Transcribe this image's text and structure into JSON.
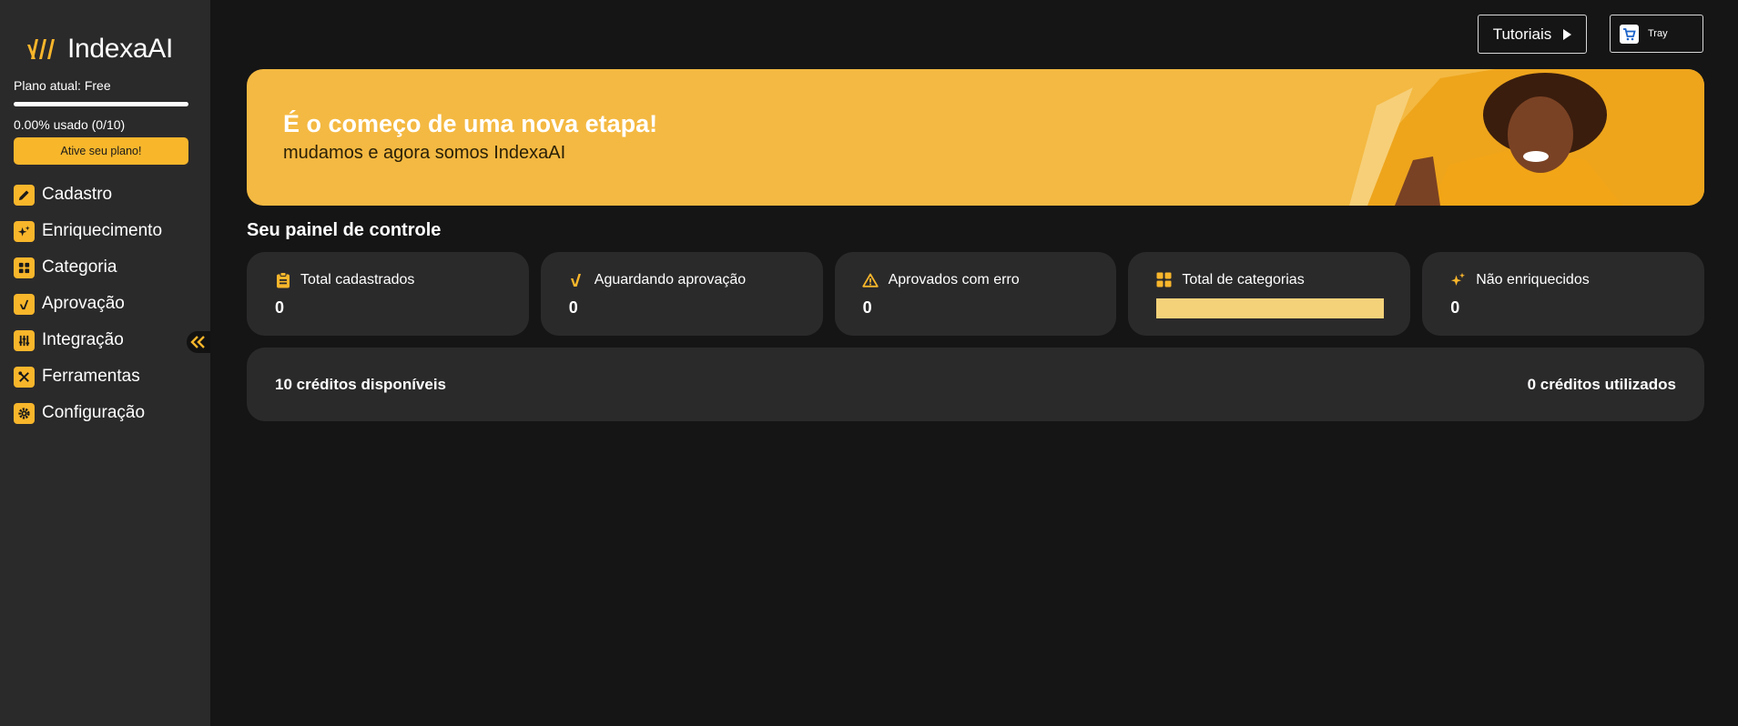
{
  "brand": {
    "name": "IndexaAI",
    "accent": "#f8b62b"
  },
  "sidebar": {
    "plan_label": "Plano atual: Free",
    "usage_fraction": 0.0,
    "usage_label": "0.00% usado (0/10)",
    "activate_label": "Ative seu plano!",
    "items": [
      {
        "label": "Cadastro",
        "icon": "pencil-icon"
      },
      {
        "label": "Enriquecimento",
        "icon": "sparkles-icon"
      },
      {
        "label": "Categoria",
        "icon": "grid-icon"
      },
      {
        "label": "Aprovação",
        "icon": "check-icon"
      },
      {
        "label": "Integração",
        "icon": "sliders-icon"
      },
      {
        "label": "Ferramentas",
        "icon": "tools-icon"
      },
      {
        "label": "Configuração",
        "icon": "gear-icon"
      }
    ]
  },
  "topbar": {
    "tutorials_label": "Tutoriais",
    "integration_label": "Tray"
  },
  "banner": {
    "title": "É o começo de uma nova etapa!",
    "subtitle": "mudamos e agora somos IndexaAI"
  },
  "panel": {
    "title": "Seu painel de controle",
    "cards": [
      {
        "label": "Total cadastrados",
        "value": "0",
        "icon": "clipboard-icon"
      },
      {
        "label": "Aguardando aprovação",
        "value": "0",
        "icon": "check-icon"
      },
      {
        "label": "Aprovados com erro",
        "value": "0",
        "icon": "warning-icon"
      },
      {
        "label": "Total de categorias",
        "icon": "grid-icon"
      },
      {
        "label": "Não enriquecidos",
        "value": "0",
        "icon": "sparkles-icon"
      }
    ],
    "credits_available": "10 créditos disponíveis",
    "credits_used": "0 créditos utilizados"
  }
}
